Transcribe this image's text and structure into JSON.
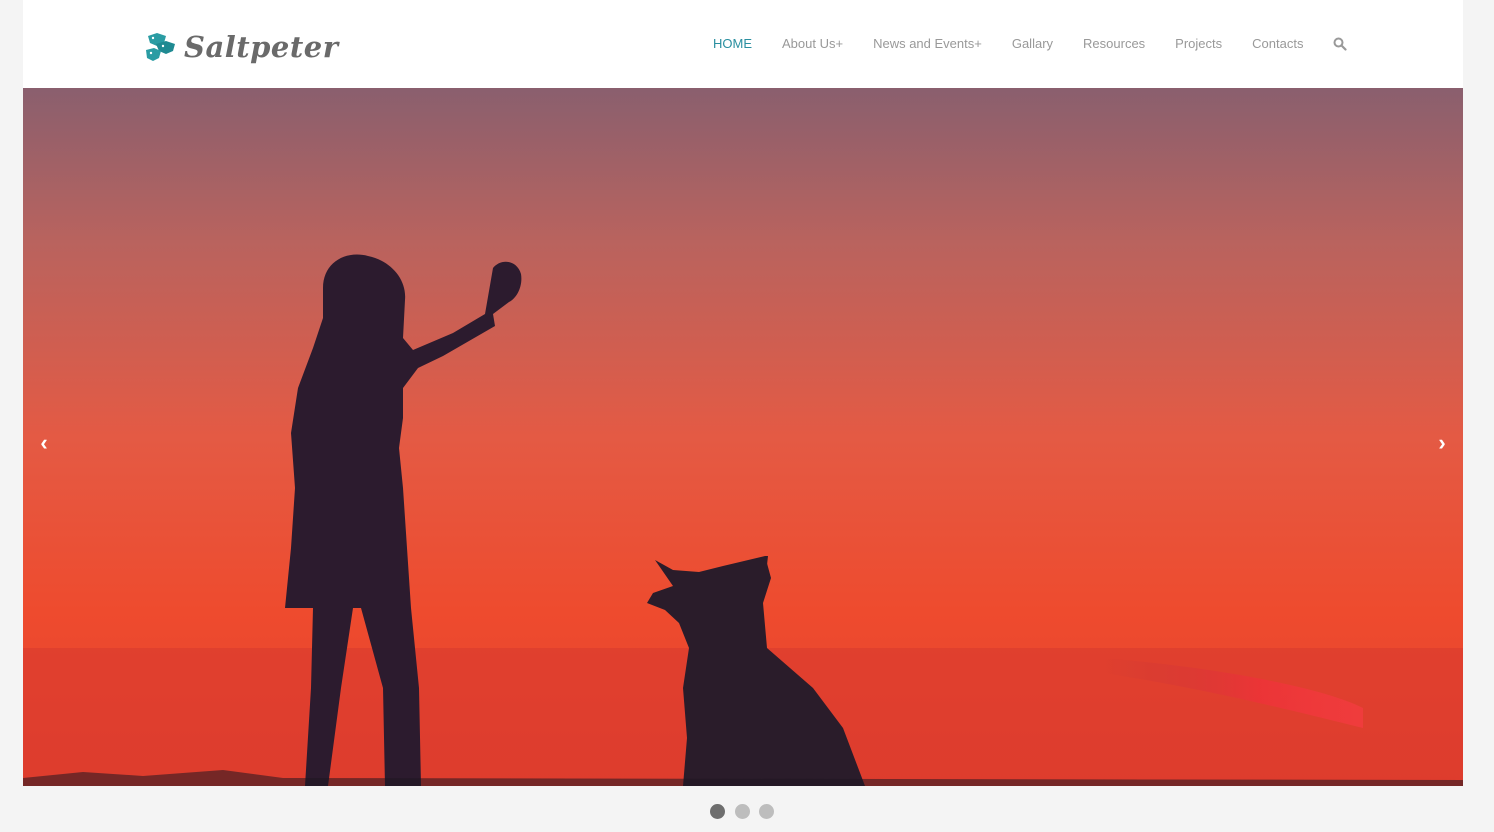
{
  "brand": {
    "name": "Saltpeter",
    "logo_icon": "dog-heads-icon",
    "accent_color": "#2a8fa0"
  },
  "nav": {
    "items": [
      {
        "label": "HOME",
        "active": true
      },
      {
        "label": "About Us+"
      },
      {
        "label": "News and Events+"
      },
      {
        "label": "Gallary"
      },
      {
        "label": "Resources"
      },
      {
        "label": "Projects"
      },
      {
        "label": "Contacts"
      }
    ],
    "search_icon": "search-icon"
  },
  "slider": {
    "prev_label": "‹",
    "next_label": "›",
    "slide_count": 3,
    "active_slide": 1,
    "image": "silhouette-girl-and-dog-at-sunset"
  }
}
